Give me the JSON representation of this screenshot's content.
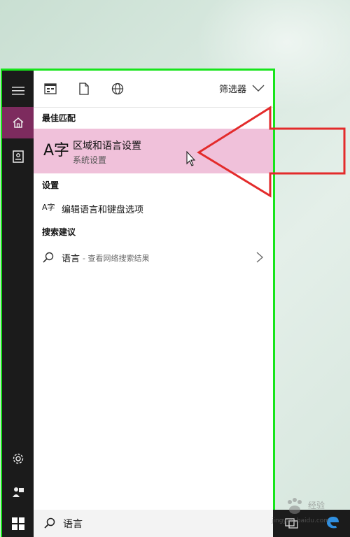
{
  "topbar": {
    "filter_label": "筛选器"
  },
  "sections": {
    "best_match": "最佳匹配",
    "settings": "设置",
    "search_suggestions": "搜索建议"
  },
  "best_match": {
    "icon_glyph": "A字",
    "title": "区域和语言设置",
    "subtitle": "系统设置"
  },
  "settings_result": {
    "label": "编辑语言和键盘选项"
  },
  "suggestion": {
    "term": "语言",
    "hint": "- 查看网络搜索结果"
  },
  "search": {
    "query": "语言"
  },
  "watermark": {
    "brand": "经验",
    "domain": "jingyan.baidu.com"
  },
  "colors": {
    "frame_highlight": "#17e51b",
    "selected_row": "#f0c1da",
    "home_accent": "#7d2b5e",
    "annotation_arrow": "#e32b2b"
  }
}
